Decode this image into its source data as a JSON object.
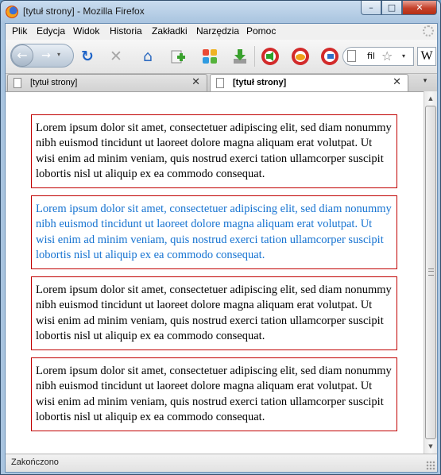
{
  "window": {
    "title": "[tytuł strony] - Mozilla Firefox",
    "minimize_glyph": "–",
    "maximize_glyph": "□",
    "close_glyph": "✕"
  },
  "menu": {
    "items": [
      "Plik",
      "Edycja",
      "Widok",
      "Historia",
      "Zakładki",
      "Narzędzia",
      "Pomoc"
    ]
  },
  "toolbar": {
    "back_glyph": "←",
    "forward_glyph": "→",
    "dropdown_glyph": "▾",
    "reload_glyph": "↻",
    "stop_glyph": "✕",
    "home_glyph": "⌂",
    "url_value": "fil",
    "search_engine_glyph": "W",
    "icons": [
      "reload-icon",
      "stop-icon",
      "home-icon",
      "bookmark-add-icon",
      "grid-icon",
      "download-icon",
      "radio-icon",
      "hand-icon",
      "lifebuoy-icon",
      "page-icon",
      "star-icon"
    ]
  },
  "tabs": [
    {
      "label": "[tytuł strony]",
      "active": false,
      "close": "✕"
    },
    {
      "label": "[tytuł strony]",
      "active": true,
      "close": "✕"
    }
  ],
  "tabs_dropdown_glyph": "▾",
  "content": {
    "paragraphs": [
      {
        "text": "Lorem ipsum dolor sit amet, consectetuer adipiscing elit, sed diam nonummy nibh euismod tincidunt ut laoreet dolore magna aliquam erat volutpat. Ut wisi enim ad minim veniam, quis nostrud exerci tation ullamcorper suscipit lobortis nisl ut aliquip ex ea commodo consequat.",
        "color": "#000000"
      },
      {
        "text": "Lorem ipsum dolor sit amet, consectetuer adipiscing elit, sed diam nonummy nibh euismod tincidunt ut laoreet dolore magna aliquam erat volutpat. Ut wisi enim ad minim veniam, quis nostrud exerci tation ullamcorper suscipit lobortis nisl ut aliquip ex ea commodo consequat.",
        "color": "#1673d1"
      },
      {
        "text": "Lorem ipsum dolor sit amet, consectetuer adipiscing elit, sed diam nonummy nibh euismod tincidunt ut laoreet dolore magna aliquam erat volutpat. Ut wisi enim ad minim veniam, quis nostrud exerci tation ullamcorper suscipit lobortis nisl ut aliquip ex ea commodo consequat.",
        "color": "#000000"
      },
      {
        "text": "Lorem ipsum dolor sit amet, consectetuer adipiscing elit, sed diam nonummy nibh euismod tincidunt ut laoreet dolore magna aliquam erat volutpat. Ut wisi enim ad minim veniam, quis nostrud exerci tation ullamcorper suscipit lobortis nisl ut aliquip ex ea commodo consequat.",
        "color": "#000000"
      }
    ],
    "border_color": "#c00000"
  },
  "status": {
    "text": "Zakończono"
  }
}
